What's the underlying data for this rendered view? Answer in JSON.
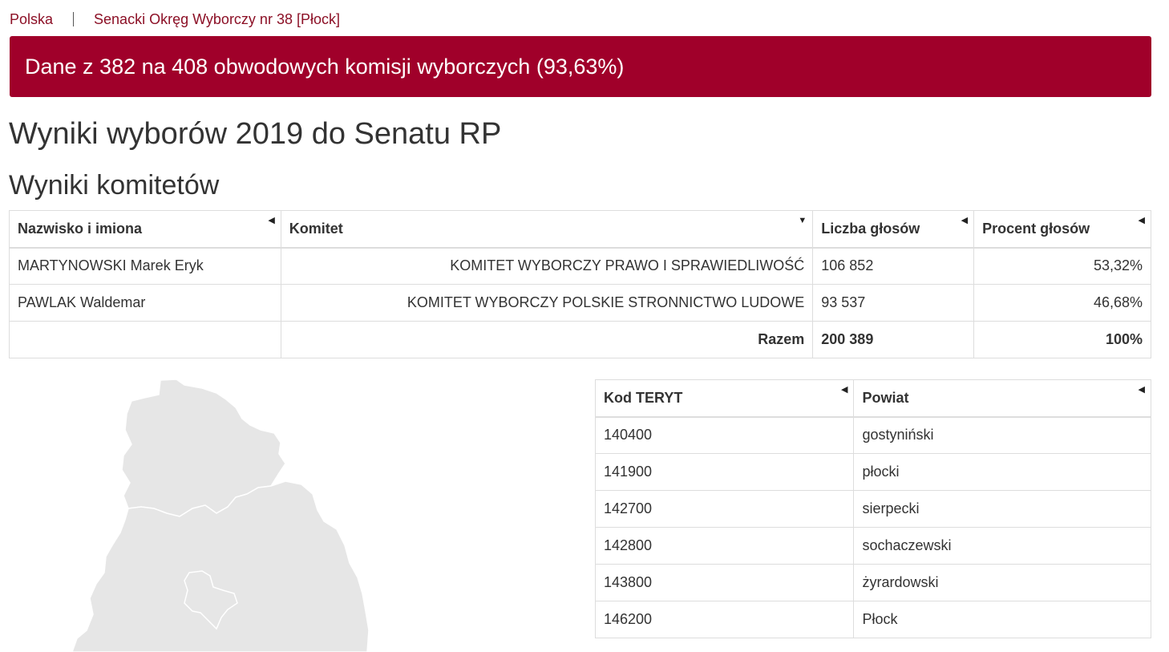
{
  "breadcrumb": {
    "home": "Polska",
    "current": "Senacki Okręg Wyborczy nr 38 [Płock]"
  },
  "banner": {
    "text": "Dane z 382 na 408 obwodowych komisji wyborczych (93,63%)"
  },
  "headings": {
    "main": "Wyniki wyborów 2019 do Senatu RP",
    "sub": "Wyniki komitetów"
  },
  "results_table": {
    "headers": [
      "Nazwisko i imiona",
      "Komitet",
      "Liczba głosów",
      "Procent głosów"
    ],
    "rows": [
      {
        "name": "MARTYNOWSKI Marek Eryk",
        "committee": "KOMITET WYBORCZY PRAWO I SPRAWIEDLIWOŚĆ",
        "votes": "106 852",
        "percent": "53,32%"
      },
      {
        "name": "PAWLAK Waldemar",
        "committee": "KOMITET WYBORCZY POLSKIE STRONNICTWO LUDOWE",
        "votes": "93 537",
        "percent": "46,68%"
      }
    ],
    "total": {
      "label": "Razem",
      "votes": "200 389",
      "percent": "100%"
    }
  },
  "teryt_table": {
    "headers": [
      "Kod TERYT",
      "Powiat"
    ],
    "rows": [
      {
        "code": "140400",
        "powiat": "gostyniński"
      },
      {
        "code": "141900",
        "powiat": "płocki"
      },
      {
        "code": "142700",
        "powiat": "sierpecki"
      },
      {
        "code": "142800",
        "powiat": "sochaczewski"
      },
      {
        "code": "143800",
        "powiat": "żyrardowski"
      },
      {
        "code": "146200",
        "powiat": "Płock"
      }
    ]
  },
  "colors": {
    "accent": "#a0002a",
    "link": "#8c1026",
    "map_fill": "#e6e6e6",
    "map_stroke": "#ffffff"
  },
  "icons": {
    "sort_left": "sort-triangle-left-icon",
    "sort_down": "sort-triangle-down-icon"
  }
}
